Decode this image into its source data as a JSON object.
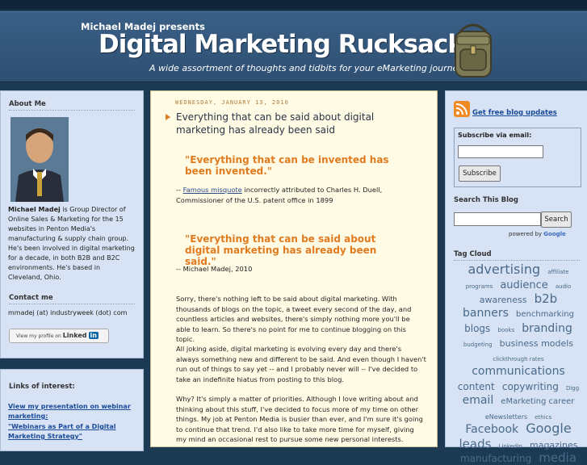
{
  "header": {
    "presents": "Michael Madej presents",
    "title": "Digital Marketing Rucksack",
    "tagline": "A wide assortment of thoughts and tidbits for your eMarketing journey"
  },
  "sidebar_left": {
    "about_title": "About Me",
    "about_name": "Michael Madej",
    "about_text": " is Group Director of Online Sales & Marketing for the 15 websites in Penton Media's manufacturing & supply chain group. He's been involved in digital marketing for a decade, in both B2B and B2C environments. He's based in Cleveland, Ohio.",
    "contact_title": "Contact me",
    "contact_text": "mmadej (at) industryweek (dot) com",
    "linkedin_text": "View my profile on",
    "linkedin_brand": "Linked",
    "linkedin_in": "in",
    "links_title": "Links of interest:",
    "link1": "View my presentation on webinar marketing:",
    "link2": "\"Webinars as Part of a Digital Marketing Strategy\""
  },
  "post": {
    "date": "WEDNESDAY, JANUARY 13, 2010",
    "title": "Everything that can be said about digital marketing has already been said",
    "quote1": "\"Everything that can be invented has been invented.\"",
    "attr1_prefix": "-- ",
    "attr1_link": "Famous misquote",
    "attr1_rest": " incorrectly attributed to Charles H. Duell, Commissioner of the U.S. patent office in 1899",
    "quote2": "\"Everything that can be said about digital marketing has already been said.\"",
    "attr2": "-- Michael Madej, 2010",
    "para1": "Sorry, there's nothing left to be said about digital marketing.  With thousands of blogs on the topic, a tweet every second of the day, and countless articles and websites, there's simply nothing more you'll be able to learn.  So there's no point for me to continue blogging on this topic.",
    "para2": "All joking aside, digital marketing is evolving every day and there's always something new and different to be said.  And even though I haven't run out of things to say yet -- and I probably never will -- I've decided to take an indefinite hiatus from posting to this blog.",
    "para3": "Why?  It's simply a matter of priorities.  Although I love writing about and thinking about this stuff, I've decided to focus more of my time on other things.  My job at Penton Media is busier than ever, and I'm sure it's going to continue that trend.  I'd also like to take more time for myself, giving my mind an occasional rest to pursue some new personal interests."
  },
  "sidebar_right": {
    "rss_label": "Get free blog updates",
    "subscribe_label": "Subscribe via email:",
    "email_value": "",
    "subscribe_button": "Subscribe",
    "search_title": "Search This Blog",
    "search_value": "",
    "search_button": "Search",
    "powered_by": "powered by",
    "google": "Google",
    "tagcloud_title": "Tag Cloud",
    "tags": [
      {
        "t": "advertising",
        "s": 16
      },
      {
        "t": "affiliate",
        "s": 7
      },
      {
        "t": "programs",
        "s": 7
      },
      {
        "t": "audience",
        "s": 13
      },
      {
        "t": "audio",
        "s": 7
      },
      {
        "t": "awareness",
        "s": 11
      },
      {
        "t": "b2b",
        "s": 15
      },
      {
        "t": "banners",
        "s": 14
      },
      {
        "t": "benchmarking",
        "s": 10
      },
      {
        "t": "blogs",
        "s": 12
      },
      {
        "t": "books",
        "s": 7
      },
      {
        "t": "branding",
        "s": 14
      },
      {
        "t": "budgeting",
        "s": 7
      },
      {
        "t": "business models",
        "s": 11
      },
      {
        "t": "clickthrough rates",
        "s": 7
      },
      {
        "t": "communications",
        "s": 14
      },
      {
        "t": "content",
        "s": 12
      },
      {
        "t": "copywriting",
        "s": 12
      },
      {
        "t": "Digg",
        "s": 7
      },
      {
        "t": "email",
        "s": 14
      },
      {
        "t": "eMarketing career",
        "s": 10
      },
      {
        "t": "eNewsletters",
        "s": 8
      },
      {
        "t": "ethics",
        "s": 7
      },
      {
        "t": "Facebook",
        "s": 14
      },
      {
        "t": "Google",
        "s": 16
      },
      {
        "t": "leads",
        "s": 15
      },
      {
        "t": "LinkedIn",
        "s": 7
      },
      {
        "t": "magazines",
        "s": 11
      },
      {
        "t": "manufacturing",
        "s": 12
      },
      {
        "t": "media",
        "s": 15
      }
    ]
  }
}
